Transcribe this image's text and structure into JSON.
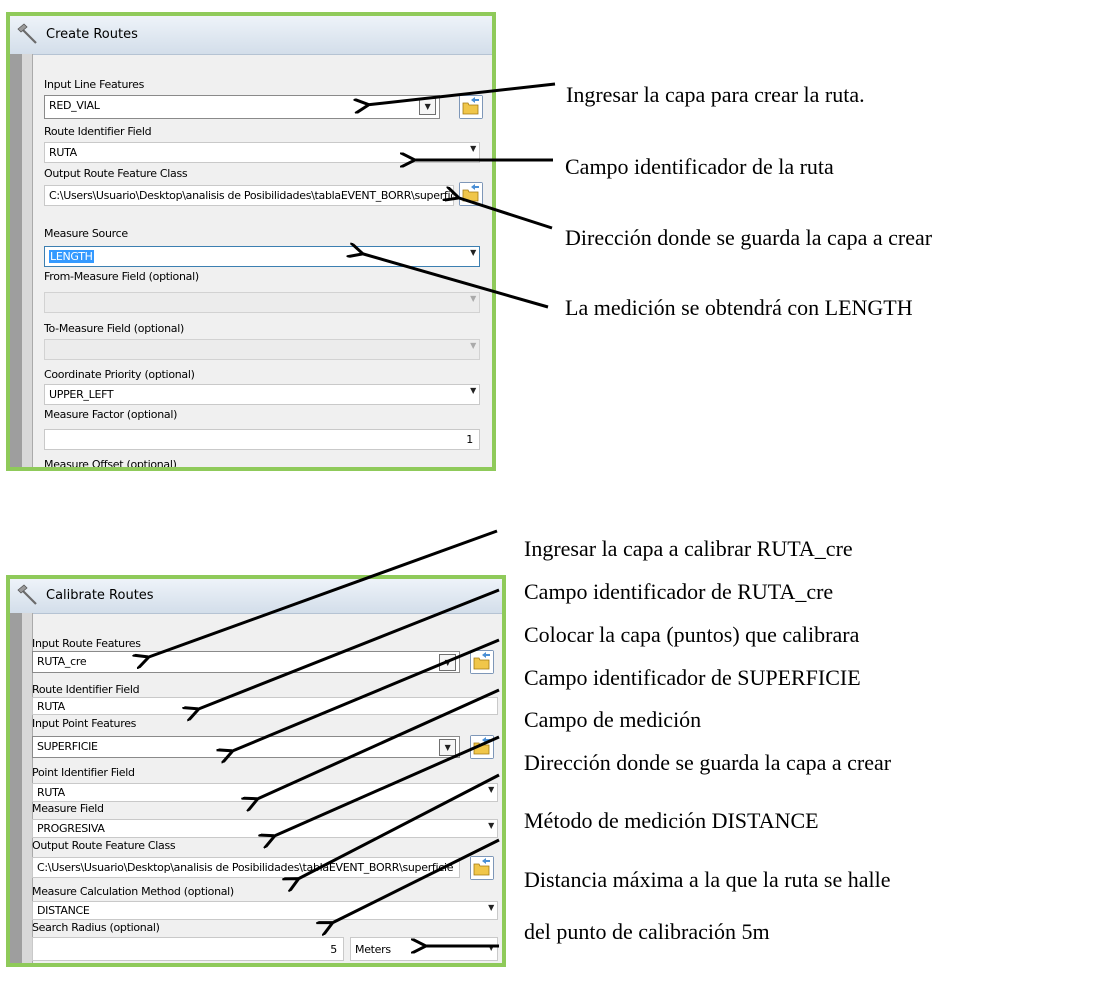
{
  "create_routes": {
    "title": "Create Routes",
    "input_line_features": {
      "label": "Input Line Features",
      "value": "RED_VIAL"
    },
    "route_identifier_field": {
      "label": "Route Identifier Field",
      "value": "RUTA"
    },
    "output_route_feature_class": {
      "label": "Output Route Feature Class",
      "value": "C:\\Users\\Usuario\\Desktop\\analisis de Posibilidades\\tablaEVENT_BORR\\superficie"
    },
    "measure_source": {
      "label": "Measure Source",
      "value": "LENGTH"
    },
    "from_measure_field": {
      "label": "From-Measure Field (optional)",
      "value": ""
    },
    "to_measure_field": {
      "label": "To-Measure Field (optional)",
      "value": ""
    },
    "coordinate_priority": {
      "label": "Coordinate Priority (optional)",
      "value": "UPPER_LEFT"
    },
    "measure_factor": {
      "label": "Measure Factor (optional)",
      "value": "1"
    },
    "measure_offset": {
      "label": "Measure Offset (optional)"
    }
  },
  "calibrate_routes": {
    "title": "Calibrate Routes",
    "input_route_features": {
      "label": "Input Route Features",
      "value": "RUTA_cre"
    },
    "route_identifier_field": {
      "label": "Route Identifier Field",
      "value": "RUTA"
    },
    "input_point_features": {
      "label": "Input Point Features",
      "value": "SUPERFICIE"
    },
    "point_identifier_field": {
      "label": "Point Identifier Field",
      "value": "RUTA"
    },
    "measure_field": {
      "label": "Measure Field",
      "value": "PROGRESIVA"
    },
    "output_route_feature_class": {
      "label": "Output Route Feature Class",
      "value": "C:\\Users\\Usuario\\Desktop\\analisis de Posibilidades\\tablaEVENT_BORR\\superficie"
    },
    "measure_calculation_method": {
      "label": "Measure Calculation Method (optional)",
      "value": "DISTANCE"
    },
    "search_radius": {
      "label": "Search Radius (optional)",
      "value": "5",
      "unit": "Meters"
    }
  },
  "annotations_top": [
    "Ingresar la capa para crear la ruta.",
    "Campo identificador de la ruta",
    "Dirección donde se guarda la capa a crear",
    "La medición se obtendrá con LENGTH"
  ],
  "annotations_bottom": [
    "Ingresar la capa a calibrar RUTA_cre",
    "Campo identificador de RUTA_cre",
    "Colocar la capa (puntos) que calibrara",
    "Campo identificador de SUPERFICIE",
    "Campo de medición",
    "Dirección donde se guarda la capa a crear",
    "Método de medición DISTANCE",
    "Distancia máxima a la que la ruta se halle",
    "del punto de calibración  5m"
  ],
  "icons": {
    "title_icon": "hammer-icon",
    "browse_icon": "open-folder-icon",
    "dropdown_icon": "chevron-down-icon"
  },
  "colors": {
    "panel_border": "#8fca5a",
    "selection": "#3399ff",
    "folder": "#f0c64a"
  }
}
